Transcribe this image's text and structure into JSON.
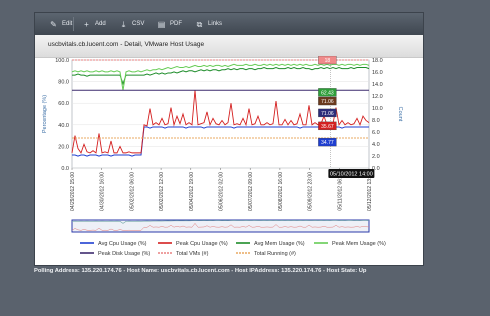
{
  "toolbar": {
    "items": [
      {
        "label": "Edit",
        "icon": "pencil-icon"
      },
      {
        "label": "Add",
        "icon": "plus-icon"
      },
      {
        "label": "CSV",
        "icon": "download-icon"
      },
      {
        "label": "PDF",
        "icon": "document-icon"
      },
      {
        "label": "Links",
        "icon": "link-icon"
      }
    ]
  },
  "panel": {
    "title": "uscbvitals.cb.lucent.com - Detail, VMware Host Usage"
  },
  "status": {
    "line": "Polling Address: 135.220.174.76 - Host Name: uscbvitals.cb.lucent.com - Host IPAddress: 135.220.174.76 - Host State: Up"
  },
  "chart_data": {
    "type": "line",
    "y_left": {
      "label": "Percentage (%)",
      "range": [
        0,
        100
      ],
      "ticks": [
        "0.0",
        "20.0",
        "40.0",
        "60.0",
        "80.0",
        "100.0"
      ]
    },
    "y_right": {
      "label": "Count",
      "range": [
        0,
        18
      ],
      "ticks": [
        "0.0",
        "2.0",
        "4.0",
        "6.0",
        "8.0",
        "10.0",
        "12.0",
        "14.0",
        "16.0",
        "18.0"
      ]
    },
    "x_ticks": [
      "04/29/2012 15:00",
      "04/30/2012 16:00",
      "05/02/2012 06:00",
      "05/02/2012 12:00",
      "05/04/2012 19:00",
      "05/06/2012 02:00",
      "05/07/2012 09:00",
      "05/08/2012 16:00",
      "05/09/2012 23:00",
      "05/11/2012 06:00",
      "05/12/2012 13:00"
    ],
    "tooltip": {
      "time": "05/10/2012 14:00"
    },
    "value_labels": [
      {
        "text": "18",
        "axis": "right",
        "value": 18,
        "color": "#f08a8a"
      },
      {
        "text": "62.43",
        "axis": "left",
        "value": 70,
        "color": "#2e9e3a"
      },
      {
        "text": "71.06",
        "axis": "left",
        "value": 62,
        "color": "#6b3a1e"
      },
      {
        "text": "71.06",
        "axis": "left",
        "value": 51,
        "color": "#2c2c7a"
      },
      {
        "text": "35.67",
        "axis": "left",
        "value": 39,
        "color": "#d42020"
      },
      {
        "text": "34.77",
        "axis": "left",
        "value": 24,
        "color": "#1f3fd0"
      }
    ],
    "series": [
      {
        "name": "Avg Cpu Usage (%)",
        "color": "#1f3fd0",
        "axis": "left",
        "values": [
          12,
          12,
          11,
          12,
          12,
          11,
          12,
          12,
          12,
          11,
          12,
          12,
          12,
          11,
          12,
          12,
          12,
          12,
          12,
          12,
          11,
          12,
          12,
          12,
          38,
          38,
          37,
          38,
          38,
          38,
          38,
          37,
          38,
          38,
          38,
          38,
          38,
          38,
          37,
          38,
          38,
          38,
          38,
          38,
          37,
          38,
          38,
          38,
          38,
          38,
          38,
          38,
          38,
          38,
          37,
          38,
          38,
          38,
          38,
          38,
          38,
          38,
          38,
          38,
          38,
          38,
          38,
          38,
          38,
          38,
          38,
          38,
          38,
          38,
          38,
          38,
          37,
          38,
          38,
          38,
          38,
          38,
          38,
          38,
          38,
          38,
          38,
          37,
          38,
          38,
          37,
          38,
          38,
          38,
          38,
          38,
          38,
          38,
          38,
          38
        ]
      },
      {
        "name": "Peak Cpu Usage (%)",
        "color": "#d41f1f",
        "axis": "left",
        "values": [
          14,
          30,
          18,
          14,
          22,
          15,
          14,
          16,
          14,
          32,
          14,
          15,
          14,
          25,
          14,
          14,
          20,
          14,
          14,
          15,
          14,
          14,
          14,
          14,
          40,
          39,
          55,
          40,
          42,
          40,
          46,
          40,
          41,
          56,
          40,
          48,
          41,
          50,
          40,
          42,
          40,
          72,
          40,
          41,
          42,
          52,
          40,
          46,
          41,
          40,
          44,
          40,
          42,
          60,
          40,
          41,
          40,
          46,
          40,
          55,
          40,
          41,
          48,
          40,
          40,
          42,
          40,
          41,
          62,
          40,
          40,
          45,
          40,
          44,
          40,
          41,
          50,
          40,
          40,
          58,
          40,
          42,
          40,
          41,
          48,
          40,
          40,
          41,
          56,
          40,
          44,
          40,
          42,
          40,
          41,
          46,
          40,
          48,
          44,
          42
        ]
      },
      {
        "name": "Avg Mem Usage (%)",
        "color": "#1e8c2a",
        "axis": "left",
        "values": [
          86,
          86,
          87,
          86,
          86,
          85,
          86,
          86,
          86,
          86,
          86,
          86,
          86,
          86,
          86,
          86,
          86,
          78,
          86,
          86,
          86,
          86,
          86,
          86,
          86,
          87,
          86,
          87,
          88,
          87,
          88,
          87,
          88,
          88,
          89,
          88,
          89,
          90,
          89,
          90,
          90,
          89,
          90,
          91,
          90,
          91,
          90,
          91,
          91,
          90,
          91,
          91,
          92,
          91,
          92,
          91,
          92,
          92,
          91,
          92,
          92,
          91,
          92,
          92,
          93,
          92,
          92,
          92,
          93,
          92,
          92,
          92,
          93,
          92,
          93,
          92,
          92,
          93,
          92,
          92,
          91,
          92,
          92,
          93,
          92,
          93,
          92,
          93,
          92,
          93,
          92,
          92,
          92,
          93,
          92,
          93,
          93,
          93,
          93,
          92
        ]
      },
      {
        "name": "Peak Mem Usage (%)",
        "color": "#66cc55",
        "axis": "left",
        "values": [
          89,
          90,
          89,
          90,
          89,
          90,
          89,
          89,
          90,
          89,
          90,
          89,
          89,
          90,
          89,
          90,
          89,
          72,
          89,
          90,
          89,
          89,
          90,
          89,
          90,
          91,
          90,
          91,
          91,
          92,
          91,
          92,
          93,
          92,
          93,
          94,
          93,
          93,
          94,
          93,
          94,
          95,
          94,
          94,
          95,
          94,
          95,
          94,
          95,
          95,
          94,
          95,
          94,
          95,
          96,
          95,
          95,
          95,
          96,
          95,
          95,
          96,
          95,
          95,
          96,
          95,
          96,
          95,
          96,
          95,
          96,
          95,
          96,
          95,
          96,
          95,
          96,
          95,
          96,
          95,
          95,
          96,
          95,
          96,
          95,
          96,
          95,
          96,
          96,
          95,
          96,
          95,
          96,
          96,
          95,
          96,
          95,
          96,
          96,
          95
        ]
      },
      {
        "name": "Peak Disk Usage (%)",
        "color": "#3d2b6e",
        "axis": "left",
        "values": [
          72,
          72,
          72,
          72,
          72,
          72,
          72,
          72,
          72,
          72,
          72,
          72,
          72,
          72,
          72,
          72,
          72,
          72,
          72,
          72,
          72,
          72,
          72,
          72,
          72,
          72,
          72,
          72,
          72,
          72,
          72,
          72,
          72,
          72,
          72,
          72,
          72,
          72,
          72,
          72,
          72,
          72,
          72,
          72,
          72,
          72,
          72,
          72,
          72,
          72,
          72,
          72,
          72,
          72,
          72,
          72,
          72,
          72,
          72,
          72,
          72,
          72,
          72,
          72,
          72,
          72,
          72,
          72,
          72,
          72,
          72,
          72,
          72,
          72,
          72,
          72,
          72,
          72,
          72,
          72,
          72,
          72,
          72,
          72,
          72,
          72,
          72,
          72,
          72,
          72,
          72,
          72,
          72,
          72,
          72,
          72,
          72,
          72,
          72,
          72
        ]
      },
      {
        "name": "Total VMs (#)",
        "color": "#e88080",
        "axis": "right",
        "values": [
          18,
          18,
          18,
          18,
          18,
          18,
          18,
          18,
          18,
          18,
          18,
          18,
          18,
          18,
          18,
          18,
          18,
          18,
          18,
          18,
          18,
          18,
          18,
          18,
          18,
          18,
          18,
          18,
          18,
          18,
          18,
          18,
          18,
          18,
          18,
          18,
          18,
          18,
          18,
          18,
          18,
          18,
          18,
          18,
          18,
          18,
          18,
          18,
          18,
          18,
          18,
          18,
          18,
          18,
          18,
          18,
          18,
          18,
          18,
          18,
          18,
          18,
          18,
          18,
          18,
          18,
          18,
          18,
          18,
          18,
          18,
          18,
          18,
          18,
          18,
          18,
          18,
          18,
          18,
          18,
          18,
          18,
          18,
          18,
          18,
          18,
          18,
          18,
          18,
          18,
          18,
          18,
          18,
          18,
          18,
          18,
          18,
          18,
          18,
          18
        ]
      },
      {
        "name": "Total Running (#)",
        "color": "#e8a860",
        "axis": "right",
        "values": [
          5,
          5,
          5,
          5,
          5,
          5,
          5,
          5,
          5,
          5,
          5,
          5,
          5,
          5,
          5,
          5,
          5,
          5,
          5,
          5,
          5,
          5,
          5,
          5,
          5,
          5,
          5,
          5,
          5,
          5,
          5,
          5,
          5,
          5,
          5,
          5,
          5,
          5,
          5,
          5,
          5,
          5,
          5,
          5,
          5,
          5,
          5,
          5,
          5,
          5,
          5,
          5,
          5,
          5,
          5,
          5,
          5,
          5,
          5,
          5,
          5,
          5,
          5,
          5,
          5,
          5,
          5,
          5,
          5,
          5,
          5,
          5,
          5,
          5,
          5,
          5,
          5,
          5,
          5,
          5,
          5,
          5,
          5,
          5,
          5,
          5,
          5,
          5,
          5,
          5,
          5,
          5,
          5,
          5,
          5,
          5,
          5,
          5,
          5,
          5
        ]
      }
    ],
    "legend": {
      "placement": "bottom"
    }
  }
}
